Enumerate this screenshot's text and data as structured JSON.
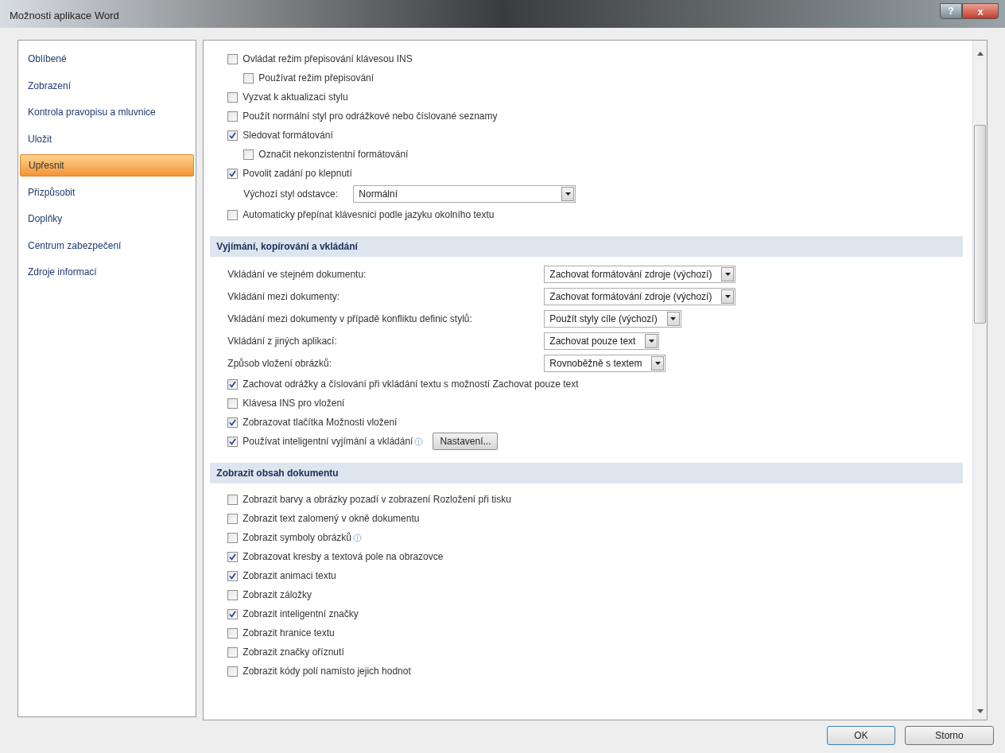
{
  "window": {
    "title": "Možnosti aplikace Word",
    "help_button": "?",
    "close_button": "x"
  },
  "sidebar": {
    "items": [
      {
        "label": "Oblíbené",
        "selected": false
      },
      {
        "label": "Zobrazení",
        "selected": false
      },
      {
        "label": "Kontrola pravopisu a mluvnice",
        "selected": false
      },
      {
        "label": "Uložit",
        "selected": false
      },
      {
        "label": "Upřesnit",
        "selected": true
      },
      {
        "label": "Přizpůsobit",
        "selected": false
      },
      {
        "label": "Doplňky",
        "selected": false
      },
      {
        "label": "Centrum zabezpečení",
        "selected": false
      },
      {
        "label": "Zdroje informací",
        "selected": false
      }
    ]
  },
  "sections": [
    {
      "items": [
        {
          "kind": "checkbox",
          "label": "Ovládat režim přepisování klávesou INS",
          "checked": false,
          "children": [
            {
              "kind": "checkbox",
              "label": "Používat režim přepisování",
              "checked": false
            }
          ]
        },
        {
          "kind": "checkbox",
          "label": "Vyzvat k aktualizaci stylu",
          "checked": false
        },
        {
          "kind": "checkbox",
          "label": "Použít normální styl pro odrážkové nebo číslované seznamy",
          "checked": false
        },
        {
          "kind": "checkbox",
          "label": "Sledovat formátování",
          "checked": true,
          "children": [
            {
              "kind": "checkbox",
              "label": "Označit nekonzistentní formátování",
              "checked": false
            }
          ]
        },
        {
          "kind": "checkbox",
          "label": "Povolit zadání po klepnutí",
          "checked": true,
          "children": [
            {
              "kind": "select",
              "label": "Výchozí styl odstavce:",
              "value": "Normální"
            }
          ]
        },
        {
          "kind": "checkbox",
          "label": "Automaticky přepínat klávesnici podle jazyku okolního textu",
          "checked": false
        }
      ]
    },
    {
      "title": "Vyjímání, kopírování a vkládání",
      "items": [
        {
          "kind": "select",
          "label": "Vkládání ve stejném dokumentu:",
          "value": "Zachovat formátování zdroje (výchozí)"
        },
        {
          "kind": "select",
          "label": "Vkládání mezi dokumenty:",
          "value": "Zachovat formátování zdroje (výchozí)"
        },
        {
          "kind": "select",
          "label": "Vkládání mezi dokumenty v případě konfliktu definic stylů:",
          "value": "Použít styly cíle (výchozí)"
        },
        {
          "kind": "select",
          "label": "Vkládání z jiných aplikací:",
          "value": "Zachovat pouze text"
        },
        {
          "kind": "select",
          "label": "Způsob vložení obrázků:",
          "value": "Rovnoběžně s textem"
        },
        {
          "kind": "checkbox",
          "label": "Zachovat odrážky a číslování při vkládání textu s možností Zachovat pouze text",
          "checked": true
        },
        {
          "kind": "checkbox",
          "label": "Klávesa INS pro vložení",
          "checked": false
        },
        {
          "kind": "checkbox",
          "label": "Zobrazovat tlačítka Možnosti vložení",
          "checked": true
        },
        {
          "kind": "checkbox",
          "label": "Používat inteligentní vyjímání a vkládání",
          "checked": true,
          "info": true,
          "button": "Nastavení..."
        }
      ]
    },
    {
      "title": "Zobrazit obsah dokumentu",
      "items": [
        {
          "kind": "checkbox",
          "label": "Zobrazit barvy a obrázky pozadí v zobrazení Rozložení při tisku",
          "checked": false
        },
        {
          "kind": "checkbox",
          "label": "Zobrazit text zalomený v okně dokumentu",
          "checked": false
        },
        {
          "kind": "checkbox",
          "label": "Zobrazit symboly obrázků",
          "checked": false,
          "info": true
        },
        {
          "kind": "checkbox",
          "label": "Zobrazovat kresby a textová pole na obrazovce",
          "checked": true
        },
        {
          "kind": "checkbox",
          "label": "Zobrazit animaci textu",
          "checked": true
        },
        {
          "kind": "checkbox",
          "label": "Zobrazit záložky",
          "checked": false
        },
        {
          "kind": "checkbox",
          "label": "Zobrazit inteligentní značky",
          "checked": true
        },
        {
          "kind": "checkbox",
          "label": "Zobrazit hranice textu",
          "checked": false
        },
        {
          "kind": "checkbox",
          "label": "Zobrazit značky oříznutí",
          "checked": false
        },
        {
          "kind": "checkbox",
          "label": "Zobrazit kódy polí namísto jejich hodnot",
          "checked": false
        }
      ]
    }
  ],
  "buttons": [
    {
      "label": "OK",
      "default": true
    },
    {
      "label": "Storno",
      "default": false
    }
  ]
}
